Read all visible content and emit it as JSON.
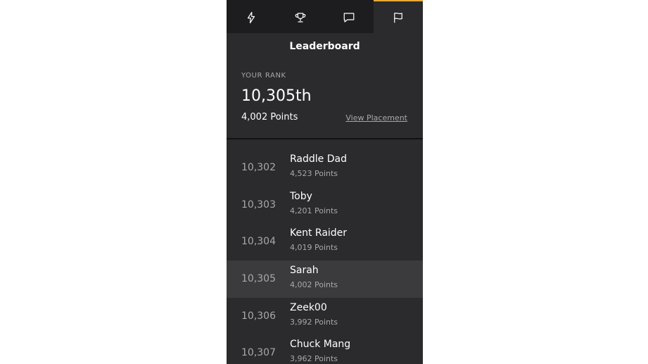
{
  "tabs": [
    {
      "icon": "lightning-icon",
      "active": false
    },
    {
      "icon": "trophy-icon",
      "active": false
    },
    {
      "icon": "chat-icon",
      "active": false
    },
    {
      "icon": "flag-icon",
      "active": true
    }
  ],
  "colors": {
    "accent": "#e8a93a",
    "panel_bg": "#2b2b2d",
    "tabbar_bg": "#1d1d1f",
    "highlight_bg": "#3b3b3e"
  },
  "leaderboard": {
    "title": "Leaderboard",
    "your_rank_label": "YOUR RANK",
    "your_rank_value": "10,305th",
    "your_points": "4,002 Points",
    "view_placement": "View Placement"
  },
  "rows": [
    {
      "rank": "10,302",
      "name": "Raddle Dad",
      "points": "4,523 Points"
    },
    {
      "rank": "10,303",
      "name": "Toby",
      "points": "4,201 Points"
    },
    {
      "rank": "10,304",
      "name": "Kent Raider",
      "points": "4,019 Points"
    },
    {
      "rank": "10,305",
      "name": "Sarah",
      "points": "4,002 Points",
      "highlight": true
    },
    {
      "rank": "10,306",
      "name": "Zeek00",
      "points": "3,992 Points"
    },
    {
      "rank": "10,307",
      "name": "Chuck Mang",
      "points": "3,962 Points"
    }
  ]
}
